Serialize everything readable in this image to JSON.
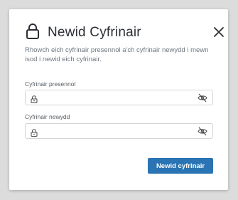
{
  "dialog": {
    "title": "Newid Cyfrinair",
    "description": "Rhowch eich cyfrinair presennol a'ch cyfrinair newydd i mewn isod i newid eich cyfrinair.",
    "title_icon": "lock-icon",
    "close_icon": "close-icon"
  },
  "fields": [
    {
      "label": "Cyfrinair presennol",
      "value": "",
      "placeholder": "",
      "leading_icon": "lock-icon",
      "trailing_icon": "eye-slash-icon"
    },
    {
      "label": "Cyfrinair newydd",
      "value": "",
      "placeholder": "",
      "leading_icon": "lock-icon",
      "trailing_icon": "eye-slash-icon"
    }
  ],
  "actions": {
    "submit_label": "Newid cyfrinair"
  },
  "colors": {
    "primary": "#2a74b3",
    "title_text": "#2b2f33",
    "description_text": "#6f7780",
    "border": "#d2d5d9"
  }
}
